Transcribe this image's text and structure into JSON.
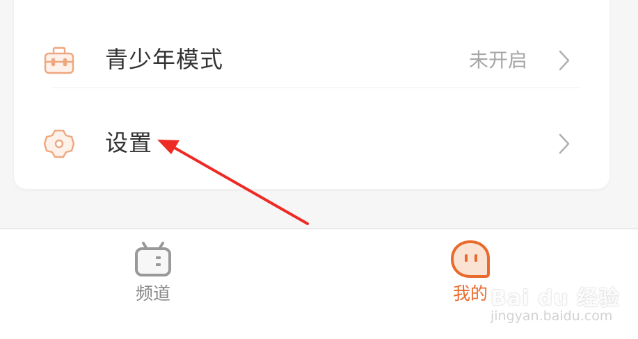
{
  "menu": {
    "items": [
      {
        "label": "青少年模式",
        "value": "未开启",
        "icon": "briefcase-icon"
      },
      {
        "label": "设置",
        "value": "",
        "icon": "gear-icon"
      }
    ]
  },
  "tabbar": {
    "tabs": [
      {
        "label": "频道",
        "icon": "calendar-tv-icon",
        "active": false
      },
      {
        "label": "我的",
        "icon": "chat-face-icon",
        "active": true
      }
    ]
  },
  "watermark": {
    "logo": "Bai du 经验",
    "url": "jingyan.baidu.com"
  },
  "colors": {
    "accent": "#e86a2c",
    "icon_outline": "#eea77e",
    "annotation_arrow": "#ee2a24",
    "text_primary": "#333333",
    "text_secondary": "#a6a6a6",
    "tab_inactive": "#888888"
  }
}
